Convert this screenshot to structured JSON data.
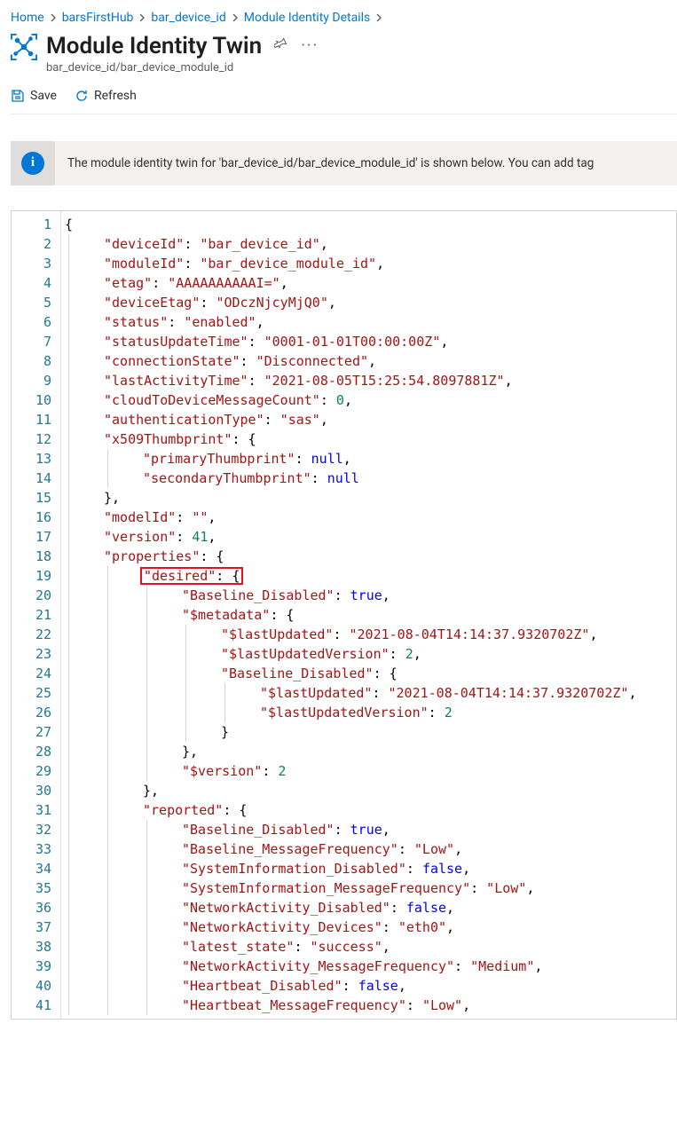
{
  "breadcrumb": {
    "items": [
      "Home",
      "barsFirstHub",
      "bar_device_id",
      "Module Identity Details"
    ]
  },
  "header": {
    "title": "Module Identity Twin",
    "subtitle": "bar_device_id/bar_device_module_id"
  },
  "toolbar": {
    "save_label": "Save",
    "refresh_label": "Refresh"
  },
  "banner": {
    "message": "The module identity twin for 'bar_device_id/bar_device_module_id' is shown below. You can add tag"
  },
  "editor": {
    "line_count": 41,
    "json_twin": {
      "deviceId": "bar_device_id",
      "moduleId": "bar_device_module_id",
      "etag": "AAAAAAAAAAI=",
      "deviceEtag": "ODczNjcyMjQ0",
      "status": "enabled",
      "statusUpdateTime": "0001-01-01T00:00:00Z",
      "connectionState": "Disconnected",
      "lastActivityTime": "2021-08-05T15:25:54.8097881Z",
      "cloudToDeviceMessageCount": 0,
      "authenticationType": "sas",
      "x509Thumbprint": {
        "primaryThumbprint": null,
        "secondaryThumbprint": null
      },
      "modelId": "",
      "version": 41,
      "properties": {
        "desired": {
          "Baseline_Disabled": true,
          "$metadata": {
            "$lastUpdated": "2021-08-04T14:14:37.9320702Z",
            "$lastUpdatedVersion": 2,
            "Baseline_Disabled": {
              "$lastUpdated": "2021-08-04T14:14:37.9320702Z",
              "$lastUpdatedVersion": 2
            }
          },
          "$version": 2
        },
        "reported": {
          "Baseline_Disabled": true,
          "Baseline_MessageFrequency": "Low",
          "SystemInformation_Disabled": false,
          "SystemInformation_MessageFrequency": "Low",
          "NetworkActivity_Disabled": false,
          "NetworkActivity_Devices": "eth0",
          "latest_state": "success",
          "NetworkActivity_MessageFrequency": "Medium",
          "Heartbeat_Disabled": false,
          "Heartbeat_MessageFrequency": "Low"
        }
      }
    },
    "highlight_line": 19,
    "lines": [
      {
        "indent": 0,
        "tokens": [
          {
            "t": "p",
            "v": "{"
          }
        ]
      },
      {
        "indent": 1,
        "tokens": [
          {
            "t": "k",
            "v": "\"deviceId\""
          },
          {
            "t": "p",
            "v": ": "
          },
          {
            "t": "k",
            "v": "\"bar_device_id\""
          },
          {
            "t": "p",
            "v": ","
          }
        ]
      },
      {
        "indent": 1,
        "tokens": [
          {
            "t": "k",
            "v": "\"moduleId\""
          },
          {
            "t": "p",
            "v": ": "
          },
          {
            "t": "k",
            "v": "\"bar_device_module_id\""
          },
          {
            "t": "p",
            "v": ","
          }
        ]
      },
      {
        "indent": 1,
        "tokens": [
          {
            "t": "k",
            "v": "\"etag\""
          },
          {
            "t": "p",
            "v": ": "
          },
          {
            "t": "k",
            "v": "\"AAAAAAAAAAI=\""
          },
          {
            "t": "p",
            "v": ","
          }
        ]
      },
      {
        "indent": 1,
        "tokens": [
          {
            "t": "k",
            "v": "\"deviceEtag\""
          },
          {
            "t": "p",
            "v": ": "
          },
          {
            "t": "k",
            "v": "\"ODczNjcyMjQ0\""
          },
          {
            "t": "p",
            "v": ","
          }
        ]
      },
      {
        "indent": 1,
        "tokens": [
          {
            "t": "k",
            "v": "\"status\""
          },
          {
            "t": "p",
            "v": ": "
          },
          {
            "t": "k",
            "v": "\"enabled\""
          },
          {
            "t": "p",
            "v": ","
          }
        ]
      },
      {
        "indent": 1,
        "tokens": [
          {
            "t": "k",
            "v": "\"statusUpdateTime\""
          },
          {
            "t": "p",
            "v": ": "
          },
          {
            "t": "k",
            "v": "\"0001-01-01T00:00:00Z\""
          },
          {
            "t": "p",
            "v": ","
          }
        ]
      },
      {
        "indent": 1,
        "tokens": [
          {
            "t": "k",
            "v": "\"connectionState\""
          },
          {
            "t": "p",
            "v": ": "
          },
          {
            "t": "k",
            "v": "\"Disconnected\""
          },
          {
            "t": "p",
            "v": ","
          }
        ]
      },
      {
        "indent": 1,
        "tokens": [
          {
            "t": "k",
            "v": "\"lastActivityTime\""
          },
          {
            "t": "p",
            "v": ": "
          },
          {
            "t": "k",
            "v": "\"2021-08-05T15:25:54.8097881Z\""
          },
          {
            "t": "p",
            "v": ","
          }
        ]
      },
      {
        "indent": 1,
        "tokens": [
          {
            "t": "k",
            "v": "\"cloudToDeviceMessageCount\""
          },
          {
            "t": "p",
            "v": ": "
          },
          {
            "t": "n",
            "v": "0"
          },
          {
            "t": "p",
            "v": ","
          }
        ]
      },
      {
        "indent": 1,
        "tokens": [
          {
            "t": "k",
            "v": "\"authenticationType\""
          },
          {
            "t": "p",
            "v": ": "
          },
          {
            "t": "k",
            "v": "\"sas\""
          },
          {
            "t": "p",
            "v": ","
          }
        ]
      },
      {
        "indent": 1,
        "tokens": [
          {
            "t": "k",
            "v": "\"x509Thumbprint\""
          },
          {
            "t": "p",
            "v": ": {"
          }
        ]
      },
      {
        "indent": 2,
        "tokens": [
          {
            "t": "k",
            "v": "\"primaryThumbprint\""
          },
          {
            "t": "p",
            "v": ": "
          },
          {
            "t": "b",
            "v": "null"
          },
          {
            "t": "p",
            "v": ","
          }
        ]
      },
      {
        "indent": 2,
        "tokens": [
          {
            "t": "k",
            "v": "\"secondaryThumbprint\""
          },
          {
            "t": "p",
            "v": ": "
          },
          {
            "t": "b",
            "v": "null"
          }
        ]
      },
      {
        "indent": 1,
        "tokens": [
          {
            "t": "p",
            "v": "},"
          }
        ]
      },
      {
        "indent": 1,
        "tokens": [
          {
            "t": "k",
            "v": "\"modelId\""
          },
          {
            "t": "p",
            "v": ": "
          },
          {
            "t": "k",
            "v": "\"\""
          },
          {
            "t": "p",
            "v": ","
          }
        ]
      },
      {
        "indent": 1,
        "tokens": [
          {
            "t": "k",
            "v": "\"version\""
          },
          {
            "t": "p",
            "v": ": "
          },
          {
            "t": "n",
            "v": "41"
          },
          {
            "t": "p",
            "v": ","
          }
        ]
      },
      {
        "indent": 1,
        "tokens": [
          {
            "t": "k",
            "v": "\"properties\""
          },
          {
            "t": "p",
            "v": ": {"
          }
        ]
      },
      {
        "indent": 2,
        "hl": true,
        "tokens": [
          {
            "t": "k",
            "v": "\"desired\""
          },
          {
            "t": "p",
            "v": ": {"
          }
        ]
      },
      {
        "indent": 3,
        "tokens": [
          {
            "t": "k",
            "v": "\"Baseline_Disabled\""
          },
          {
            "t": "p",
            "v": ": "
          },
          {
            "t": "b",
            "v": "true"
          },
          {
            "t": "p",
            "v": ","
          }
        ]
      },
      {
        "indent": 3,
        "tokens": [
          {
            "t": "k",
            "v": "\"$metadata\""
          },
          {
            "t": "p",
            "v": ": {"
          }
        ]
      },
      {
        "indent": 4,
        "tokens": [
          {
            "t": "k",
            "v": "\"$lastUpdated\""
          },
          {
            "t": "p",
            "v": ": "
          },
          {
            "t": "k",
            "v": "\"2021-08-04T14:14:37.9320702Z\""
          },
          {
            "t": "p",
            "v": ","
          }
        ]
      },
      {
        "indent": 4,
        "tokens": [
          {
            "t": "k",
            "v": "\"$lastUpdatedVersion\""
          },
          {
            "t": "p",
            "v": ": "
          },
          {
            "t": "n",
            "v": "2"
          },
          {
            "t": "p",
            "v": ","
          }
        ]
      },
      {
        "indent": 4,
        "tokens": [
          {
            "t": "k",
            "v": "\"Baseline_Disabled\""
          },
          {
            "t": "p",
            "v": ": {"
          }
        ]
      },
      {
        "indent": 5,
        "tokens": [
          {
            "t": "k",
            "v": "\"$lastUpdated\""
          },
          {
            "t": "p",
            "v": ": "
          },
          {
            "t": "k",
            "v": "\"2021-08-04T14:14:37.9320702Z\""
          },
          {
            "t": "p",
            "v": ","
          }
        ]
      },
      {
        "indent": 5,
        "tokens": [
          {
            "t": "k",
            "v": "\"$lastUpdatedVersion\""
          },
          {
            "t": "p",
            "v": ": "
          },
          {
            "t": "n",
            "v": "2"
          }
        ]
      },
      {
        "indent": 4,
        "tokens": [
          {
            "t": "p",
            "v": "}"
          }
        ]
      },
      {
        "indent": 3,
        "tokens": [
          {
            "t": "p",
            "v": "},"
          }
        ]
      },
      {
        "indent": 3,
        "tokens": [
          {
            "t": "k",
            "v": "\"$version\""
          },
          {
            "t": "p",
            "v": ": "
          },
          {
            "t": "n",
            "v": "2"
          }
        ]
      },
      {
        "indent": 2,
        "tokens": [
          {
            "t": "p",
            "v": "},"
          }
        ]
      },
      {
        "indent": 2,
        "tokens": [
          {
            "t": "k",
            "v": "\"reported\""
          },
          {
            "t": "p",
            "v": ": {"
          }
        ]
      },
      {
        "indent": 3,
        "tokens": [
          {
            "t": "k",
            "v": "\"Baseline_Disabled\""
          },
          {
            "t": "p",
            "v": ": "
          },
          {
            "t": "b",
            "v": "true"
          },
          {
            "t": "p",
            "v": ","
          }
        ]
      },
      {
        "indent": 3,
        "tokens": [
          {
            "t": "k",
            "v": "\"Baseline_MessageFrequency\""
          },
          {
            "t": "p",
            "v": ": "
          },
          {
            "t": "k",
            "v": "\"Low\""
          },
          {
            "t": "p",
            "v": ","
          }
        ]
      },
      {
        "indent": 3,
        "tokens": [
          {
            "t": "k",
            "v": "\"SystemInformation_Disabled\""
          },
          {
            "t": "p",
            "v": ": "
          },
          {
            "t": "b",
            "v": "false"
          },
          {
            "t": "p",
            "v": ","
          }
        ]
      },
      {
        "indent": 3,
        "tokens": [
          {
            "t": "k",
            "v": "\"SystemInformation_MessageFrequency\""
          },
          {
            "t": "p",
            "v": ": "
          },
          {
            "t": "k",
            "v": "\"Low\""
          },
          {
            "t": "p",
            "v": ","
          }
        ]
      },
      {
        "indent": 3,
        "tokens": [
          {
            "t": "k",
            "v": "\"NetworkActivity_Disabled\""
          },
          {
            "t": "p",
            "v": ": "
          },
          {
            "t": "b",
            "v": "false"
          },
          {
            "t": "p",
            "v": ","
          }
        ]
      },
      {
        "indent": 3,
        "tokens": [
          {
            "t": "k",
            "v": "\"NetworkActivity_Devices\""
          },
          {
            "t": "p",
            "v": ": "
          },
          {
            "t": "k",
            "v": "\"eth0\""
          },
          {
            "t": "p",
            "v": ","
          }
        ]
      },
      {
        "indent": 3,
        "tokens": [
          {
            "t": "k",
            "v": "\"latest_state\""
          },
          {
            "t": "p",
            "v": ": "
          },
          {
            "t": "k",
            "v": "\"success\""
          },
          {
            "t": "p",
            "v": ","
          }
        ]
      },
      {
        "indent": 3,
        "tokens": [
          {
            "t": "k",
            "v": "\"NetworkActivity_MessageFrequency\""
          },
          {
            "t": "p",
            "v": ": "
          },
          {
            "t": "k",
            "v": "\"Medium\""
          },
          {
            "t": "p",
            "v": ","
          }
        ]
      },
      {
        "indent": 3,
        "tokens": [
          {
            "t": "k",
            "v": "\"Heartbeat_Disabled\""
          },
          {
            "t": "p",
            "v": ": "
          },
          {
            "t": "b",
            "v": "false"
          },
          {
            "t": "p",
            "v": ","
          }
        ]
      },
      {
        "indent": 3,
        "tokens": [
          {
            "t": "k",
            "v": "\"Heartbeat_MessageFrequency\""
          },
          {
            "t": "p",
            "v": ": "
          },
          {
            "t": "k",
            "v": "\"Low\""
          },
          {
            "t": "p",
            "v": ","
          }
        ]
      }
    ]
  }
}
